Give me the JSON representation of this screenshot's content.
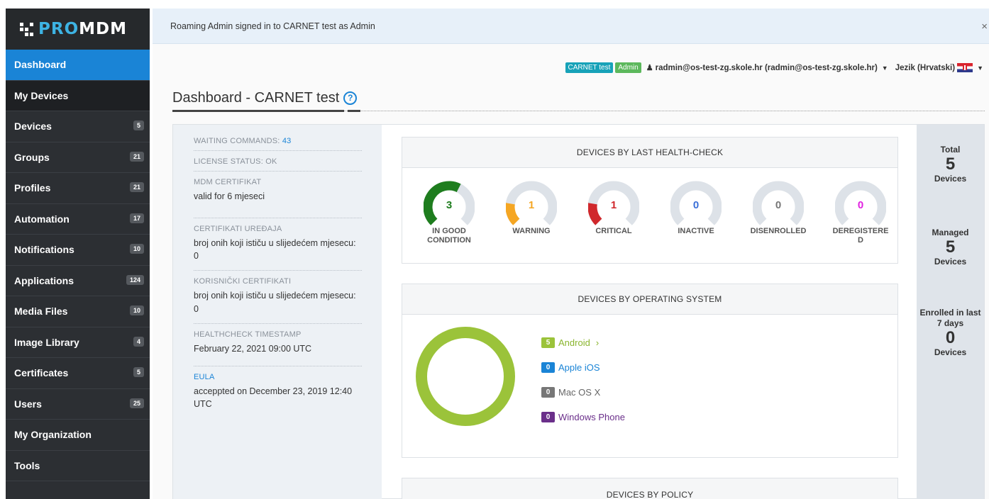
{
  "logo": {
    "brand_pro": "PRO",
    "brand_mdm": "MDM"
  },
  "sidebar": {
    "items": [
      {
        "label": "Dashboard",
        "badge": null
      },
      {
        "label": "My Devices",
        "badge": null
      },
      {
        "label": "Devices",
        "badge": "5"
      },
      {
        "label": "Groups",
        "badge": "21"
      },
      {
        "label": "Profiles",
        "badge": "21"
      },
      {
        "label": "Automation",
        "badge": "17"
      },
      {
        "label": "Notifications",
        "badge": "10"
      },
      {
        "label": "Applications",
        "badge": "124"
      },
      {
        "label": "Media Files",
        "badge": "10"
      },
      {
        "label": "Image Library",
        "badge": "4"
      },
      {
        "label": "Certificates",
        "badge": "5"
      },
      {
        "label": "Users",
        "badge": "25"
      },
      {
        "label": "My Organization",
        "badge": null
      },
      {
        "label": "Tools",
        "badge": null
      }
    ]
  },
  "notice": {
    "text": "Roaming Admin signed in to CARNET test as Admin",
    "close": "×"
  },
  "userbar": {
    "org_tag": "CARNET test",
    "role_tag": "Admin",
    "user": "radmin@os-test-zg.skole.hr (radmin@os-test-zg.skole.hr)",
    "language": "Jezik (Hrvatski)"
  },
  "page": {
    "title": "Dashboard - CARNET test",
    "help": "?"
  },
  "info": {
    "waiting_label": "WAITING COMMANDS:",
    "waiting_count": "43",
    "license": "LICENSE STATUS: OK",
    "mdm_cert_head": "MDM CERTIFIKAT",
    "mdm_cert_val": "valid for 6 mjeseci",
    "device_cert_head": "CERTIFIKATI UREĐAJA",
    "device_cert_val": "broj onih koji ističu u slijedećem mjesecu: 0",
    "user_cert_head": "KORISNIČKI CERTIFIKATI",
    "user_cert_val": "broj onih koji ističu u slijedećem mjesecu: 0",
    "health_head": "HEALTHCHECK TIMESTAMP",
    "health_val": "February 22, 2021 09:00 UTC",
    "eula_head": "EULA",
    "eula_val": "acceppted on December 23, 2019 12:40 UTC"
  },
  "health": {
    "title": "DEVICES BY LAST HEALTH-CHECK",
    "total": 5,
    "gauges": [
      {
        "value": 3,
        "label_1": "IN GOOD",
        "label_2": "CONDITION",
        "color": "#1e7d1e"
      },
      {
        "value": 1,
        "label_1": "WARNING",
        "label_2": "",
        "color": "#f5a623"
      },
      {
        "value": 1,
        "label_1": "CRITICAL",
        "label_2": "",
        "color": "#d0282c"
      },
      {
        "value": 0,
        "label_1": "INACTIVE",
        "label_2": "",
        "color": "#3a6fd8"
      },
      {
        "value": 0,
        "label_1": "DISENROLLED",
        "label_2": "",
        "color": "#777777"
      },
      {
        "value": 0,
        "label_1": "DEREGISTERE",
        "label_2": "D",
        "color": "#e020e0"
      }
    ]
  },
  "os": {
    "title": "DEVICES BY OPERATING SYSTEM",
    "items": [
      {
        "count": "5",
        "name": "Android",
        "chevron": "›",
        "color": "#9bc33a",
        "text_color": "#8ab52e"
      },
      {
        "count": "0",
        "name": "Apple iOS",
        "chevron": "",
        "color": "#1a84d6",
        "text_color": "#1a84d6"
      },
      {
        "count": "0",
        "name": "Mac OS X",
        "chevron": "",
        "color": "#777777",
        "text_color": "#666666"
      },
      {
        "count": "0",
        "name": "Windows Phone",
        "chevron": "",
        "color": "#6a2f8a",
        "text_color": "#6a2f8a"
      }
    ]
  },
  "policy": {
    "title": "DEVICES BY POLICY"
  },
  "stats": {
    "total_label": "Total",
    "total_value": "5",
    "total_unit": "Devices",
    "managed_label": "Managed",
    "managed_value": "5",
    "managed_unit": "Devices",
    "enrolled_label": "Enrolled in last 7 days",
    "enrolled_value": "0",
    "enrolled_unit": "Devices"
  }
}
